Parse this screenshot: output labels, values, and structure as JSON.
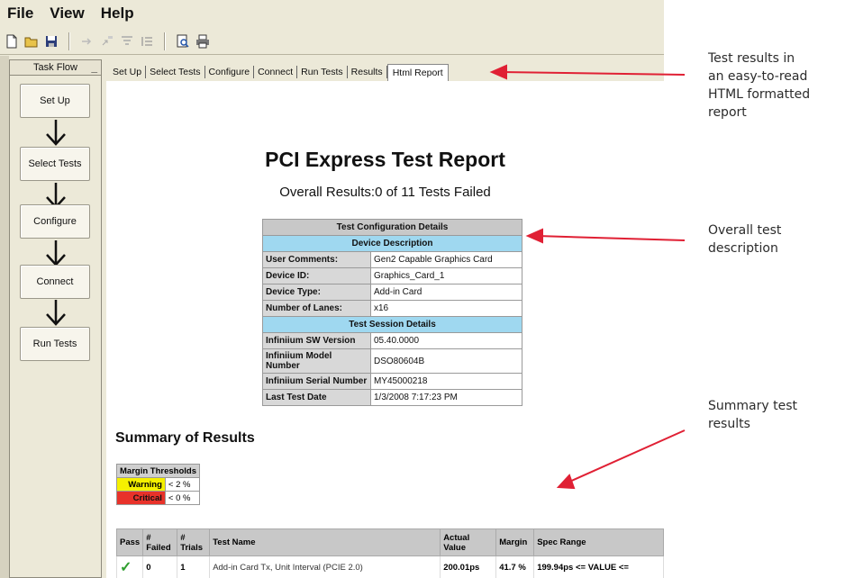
{
  "menu": {
    "items": [
      "File",
      "View",
      "Help"
    ]
  },
  "toolbar": {
    "icons": [
      "new-file-icon",
      "open-folder-icon",
      "save-icon",
      "arrow-icon",
      "select-icon",
      "filter-icon",
      "list-icon",
      "print-preview-icon",
      "print-icon"
    ]
  },
  "taskflow": {
    "title": "Task Flow",
    "minimize": "_",
    "steps": [
      "Set Up",
      "Select Tests",
      "Configure",
      "Connect",
      "Run Tests"
    ]
  },
  "tabs": [
    "Set Up",
    "Select Tests",
    "Configure",
    "Connect",
    "Run Tests",
    "Results",
    "Html Report"
  ],
  "report": {
    "title": "PCI Express Test Report",
    "overall": "Overall Results:0 of 11 Tests Failed",
    "config": {
      "header": "Test Configuration Details",
      "device_header": "Device Description",
      "device_rows": [
        {
          "label": "User Comments:",
          "value": "Gen2 Capable Graphics Card"
        },
        {
          "label": "Device ID:",
          "value": "Graphics_Card_1"
        },
        {
          "label": "Device Type:",
          "value": "Add-in Card"
        },
        {
          "label": "Number of Lanes:",
          "value": "x16"
        }
      ],
      "session_header": "Test Session Details",
      "session_rows": [
        {
          "label": "Infiniium SW Version",
          "value": "05.40.0000"
        },
        {
          "label": "Infiniium Model Number",
          "value": "DSO80604B"
        },
        {
          "label": "Infiniium Serial Number",
          "value": "MY45000218"
        },
        {
          "label": "Last Test Date",
          "value": "1/3/2008 7:17:23 PM"
        }
      ]
    },
    "summary_title": "Summary of Results",
    "thresholds": {
      "header": "Margin Thresholds",
      "warning_label": "Warning",
      "warning_value": "< 2 %",
      "critical_label": "Critical",
      "critical_value": "< 0 %",
      "warning_color": "#f5f000",
      "critical_color": "#e8322a"
    },
    "results": {
      "columns": [
        "Pass",
        "# Failed",
        "# Trials",
        "Test Name",
        "Actual Value",
        "Margin",
        "Spec Range"
      ],
      "rows": [
        {
          "pass": "✓",
          "failed": "0",
          "trials": "1",
          "name": "Add-in Card Tx, Unit Interval (PCIE 2.0)",
          "actual": "200.01ps",
          "margin": "41.7 %",
          "spec": "199.94ps <= VALUE <="
        }
      ]
    }
  },
  "annotations": {
    "a1": [
      "Test results in",
      "an easy-to-read",
      "HTML formatted",
      "report"
    ],
    "a2": [
      "Overall test",
      "description"
    ],
    "a3": [
      "Summary test",
      "results"
    ],
    "arrow_color": "#e02034"
  }
}
